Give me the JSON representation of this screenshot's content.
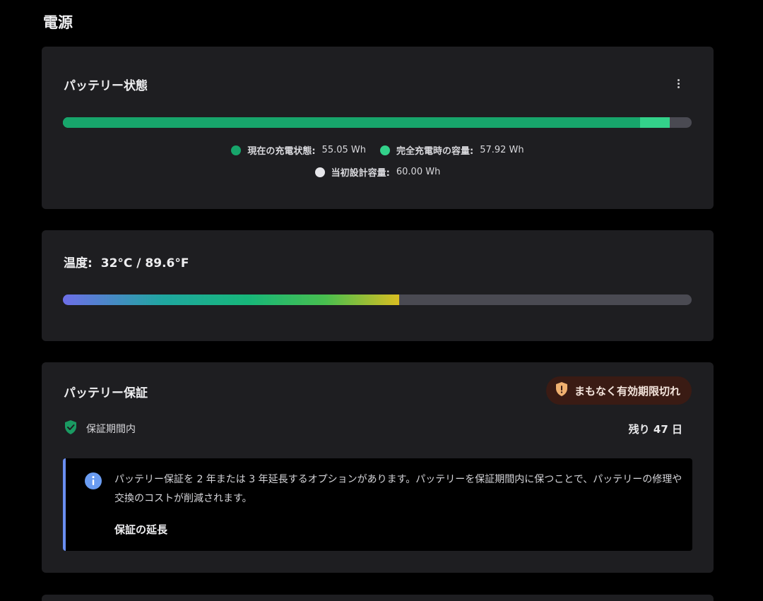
{
  "page": {
    "title": "電源"
  },
  "battery_status": {
    "title": "パッテリー状態",
    "menu_icon": "more-vertical-icon",
    "bar": {
      "current_wh": 55.05,
      "full_charge_wh": 57.92,
      "design_wh": 60.0,
      "colors": {
        "current": "#17a56b",
        "full": "#33d18a",
        "design": "#4a4a52"
      }
    },
    "legend": {
      "current_label": "現在の充電状態:",
      "current_value": "55.05 Wh",
      "full_label": "完全充電時の容量:",
      "full_value": "57.92 Wh",
      "design_label": "当初設計容量:",
      "design_value": "60.00 Wh"
    }
  },
  "temperature": {
    "title": "温度:",
    "value": "32°C / 89.6°F",
    "bar_fraction": 0.535
  },
  "warranty": {
    "title": "パッテリー保証",
    "badge": {
      "icon": "shield-alert-icon",
      "label": "まもなく有効期限切れ",
      "color": "#f0b070"
    },
    "status": {
      "icon": "shield-check-icon",
      "label": "保証期間内"
    },
    "remaining": "残り 47 日",
    "info": {
      "icon": "info-icon",
      "text": "パッテリー保証を 2 年または 3 年延長するオプションがあります。パッテリーを保証期間内に保つことで、パッテリーの修理や交換のコストが削減されます。",
      "link": "保証の延長"
    }
  }
}
